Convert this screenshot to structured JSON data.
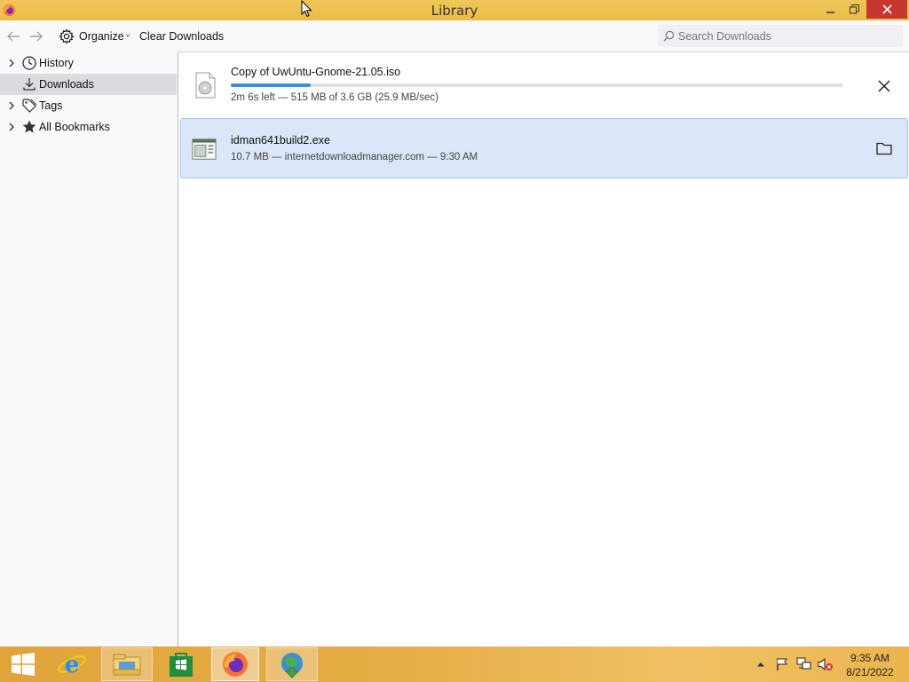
{
  "window": {
    "title": "Library"
  },
  "toolbar": {
    "organize_label": "Organize",
    "clear_label": "Clear Downloads",
    "search_placeholder": "Search Downloads"
  },
  "sidebar": {
    "items": [
      {
        "label": "History",
        "icon": "clock-icon",
        "expandable": true
      },
      {
        "label": "Downloads",
        "icon": "download-icon",
        "expandable": false,
        "selected": true
      },
      {
        "label": "Tags",
        "icon": "tag-icon",
        "expandable": true
      },
      {
        "label": "All Bookmarks",
        "icon": "star-icon",
        "expandable": true
      }
    ]
  },
  "downloads": [
    {
      "name": "Copy of UwUntu-Gnome-21.05.iso",
      "status": "2m 6s left — 515 MB of 3.6 GB (25.9 MB/sec)",
      "progress": 0.13,
      "action": "cancel-icon"
    },
    {
      "name": "idman641build2.exe",
      "status": "10.7 MB — internetdownloadmanager.com — 9:30 AM",
      "action": "folder-icon",
      "selected": true
    }
  ],
  "taskbar": {
    "apps": [
      "windows-start-icon",
      "internet-explorer-icon",
      "file-explorer-icon",
      "windows-store-icon",
      "firefox-icon",
      "idm-icon"
    ],
    "time": "9:35 AM",
    "date": "8/21/2022"
  },
  "colors": {
    "titlebar": "#e9bd47",
    "close_button": "#c7372f",
    "selection": "#dbe7f8",
    "progress": "#3b8be0"
  }
}
